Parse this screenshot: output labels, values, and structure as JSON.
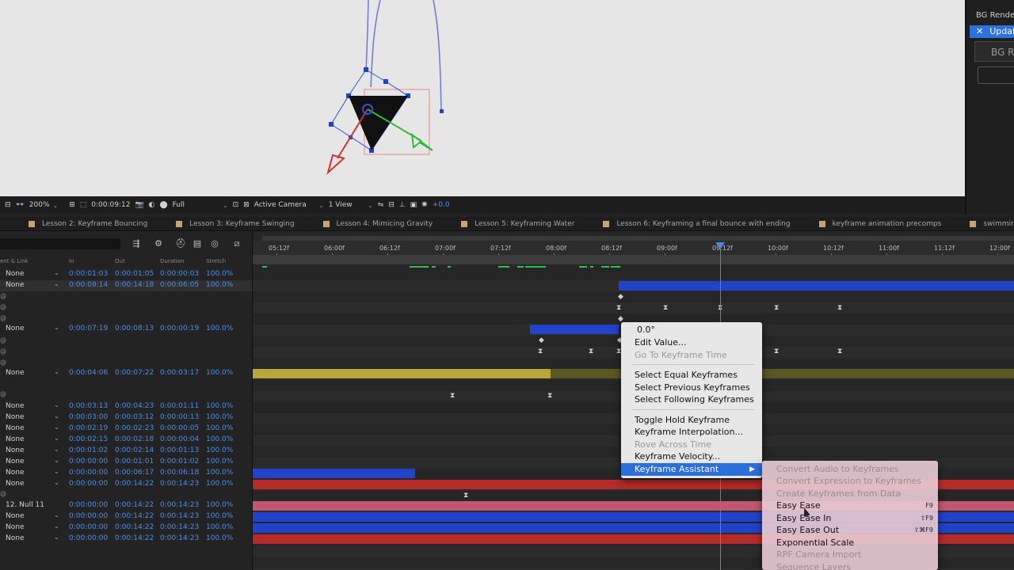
{
  "viewer": {},
  "right_panel": {
    "title": "BG Renderer",
    "update_label": "Update",
    "box_label": "BG Ren"
  },
  "viewer_toolbar": {
    "zoom": "200%",
    "timecode": "0:00:09:12",
    "resolution": "Full",
    "camera": "Active Camera",
    "views": "1 View",
    "exposure": "+0.0"
  },
  "tabs": [
    {
      "label": "Lesson 2: Keyframe Bouncing"
    },
    {
      "label": "Lesson 3: Keyframe Swinging"
    },
    {
      "label": "Lesson 4: Mimicing Gravity"
    },
    {
      "label": "Lesson 5: Keyframing Water"
    },
    {
      "label": "Lesson 6: Keyframing a final bounce with ending"
    },
    {
      "label": "keyframe animation precomps"
    },
    {
      "label": "swimming ball pre"
    }
  ],
  "columns": {
    "parent": "ent & Link",
    "in": "In",
    "out": "Out",
    "duration": "Duration",
    "stretch": "Stretch"
  },
  "layers": [
    {
      "parent": "None",
      "in": "0:00:01:03",
      "out": "0:00:01:05",
      "duration": "0:00:00:03",
      "stretch": "100.0%"
    },
    {
      "parent": "None",
      "in": "0:00:08:14",
      "out": "0:00:14:18",
      "duration": "0:00:06:05",
      "stretch": "100.0%"
    },
    {
      "parent": "None",
      "in": "0:00:07:19",
      "out": "0:00:08:13",
      "duration": "0:00:00:19",
      "stretch": "100.0%"
    },
    {
      "parent": "None",
      "in": "0:00:04:06",
      "out": "0:00:07:22",
      "duration": "0:00:03:17",
      "stretch": "100.0%"
    },
    {
      "parent": "None",
      "in": "0:00:03:13",
      "out": "0:00:04:23",
      "duration": "0:00:01:11",
      "stretch": "100.0%"
    },
    {
      "parent": "None",
      "in": "0:00:03:00",
      "out": "0:00:03:12",
      "duration": "0:00:00:13",
      "stretch": "100.0%"
    },
    {
      "parent": "None",
      "in": "0:00:02:19",
      "out": "0:00:02:23",
      "duration": "0:00:00:05",
      "stretch": "100.0%"
    },
    {
      "parent": "None",
      "in": "0:00:02:15",
      "out": "0:00:02:18",
      "duration": "0:00:00:04",
      "stretch": "100.0%"
    },
    {
      "parent": "None",
      "in": "0:00:01:02",
      "out": "0:00:02:14",
      "duration": "0:00:01:13",
      "stretch": "100.0%"
    },
    {
      "parent": "None",
      "in": "0:00:00:00",
      "out": "0:00:01:01",
      "duration": "0:00:01:02",
      "stretch": "100.0%"
    },
    {
      "parent": "None",
      "in": "0:00:00:00",
      "out": "0:00:06:17",
      "duration": "0:00:06:18",
      "stretch": "100.0%"
    },
    {
      "parent": "None",
      "in": "0:00:00:00",
      "out": "0:00:14:22",
      "duration": "0:00:14:23",
      "stretch": "100.0%"
    },
    {
      "parent": "12. Null 11",
      "in": "0:00:00:00",
      "out": "0:00:14:22",
      "duration": "0:00:14:23",
      "stretch": "100.0%"
    },
    {
      "parent": "None",
      "in": "0:00:00:00",
      "out": "0:00:14:22",
      "duration": "0:00:14:23",
      "stretch": "100.0%"
    },
    {
      "parent": "None",
      "in": "0:00:00:00",
      "out": "0:00:14:22",
      "duration": "0:00:14:23",
      "stretch": "100.0%"
    },
    {
      "parent": "None",
      "in": "0:00:00:00",
      "out": "0:00:14:22",
      "duration": "0:00:14:23",
      "stretch": "100.0%"
    }
  ],
  "ruler": [
    "05:12f",
    "06:00f",
    "06:12f",
    "07:00f",
    "07:12f",
    "08:00f",
    "08:12f",
    "09:00f",
    "09:12f",
    "10:00f",
    "10:12f",
    "11:00f",
    "11:12f",
    "12:00f"
  ],
  "context_menu": {
    "value": "0.0°",
    "edit_value": "Edit Value...",
    "go_to_keyframe_time": "Go To Keyframe Time",
    "select_equal": "Select Equal Keyframes",
    "select_previous": "Select Previous Keyframes",
    "select_following": "Select Following Keyframes",
    "toggle_hold": "Toggle Hold Keyframe",
    "interpolation": "Keyframe Interpolation...",
    "rove": "Rove Across Time",
    "velocity": "Keyframe Velocity...",
    "assistant": "Keyframe Assistant"
  },
  "submenu": {
    "convert_audio": "Convert Audio to Keyframes",
    "convert_expression": "Convert Expression to Keyframes",
    "create_from_data": "Create Keyframes from Data",
    "easy_ease": "Easy Ease",
    "easy_ease_sc": "F9",
    "easy_ease_in": "Easy Ease In",
    "easy_ease_in_sc": "⇧F9",
    "easy_ease_out": "Easy Ease Out",
    "easy_ease_out_sc": "⇧⌘F9",
    "exponential_scale": "Exponential Scale",
    "rpf_camera_import": "RPF Camera Import",
    "sequence_layers": "Sequence Layers"
  },
  "colors": {
    "layer_blue": "#2043c9",
    "layer_yellow": "#b8a63a",
    "layer_red": "#b72a2a",
    "layer_pink": "#c1566f",
    "highlight": "#2c6fdc",
    "timecode_blue": "#4d8fe8"
  }
}
